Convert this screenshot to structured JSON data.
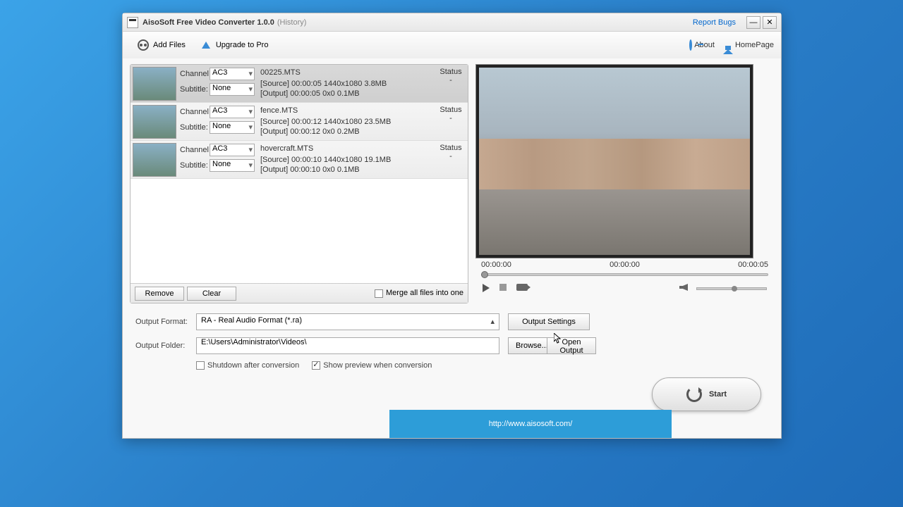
{
  "title": {
    "app": "AisoSoft Free Video Converter 1.0.0",
    "history": "(History)",
    "report": "Report Bugs"
  },
  "toolbar": {
    "addFiles": "Add Files",
    "upgrade": "Upgrade to Pro",
    "about": "About",
    "homepage": "HomePage"
  },
  "labels": {
    "channel": "Channel:",
    "subtitle": "Subtitle:",
    "status": "Status"
  },
  "files": [
    {
      "name": "00225.MTS",
      "channel": "AC3",
      "subtitle": "None",
      "source": "[Source]  00:00:05  1440x1080  3.8MB",
      "output": "[Output]  00:00:05  0x0  0.1MB",
      "status": "-",
      "sel": true
    },
    {
      "name": "fence.MTS",
      "channel": "AC3",
      "subtitle": "None",
      "source": "[Source]  00:00:12  1440x1080  23.5MB",
      "output": "[Output]  00:00:12  0x0  0.2MB",
      "status": "-",
      "sel": false
    },
    {
      "name": "hovercraft.MTS",
      "channel": "AC3",
      "subtitle": "None",
      "source": "[Source]  00:00:10  1440x1080  19.1MB",
      "output": "[Output]  00:00:10  0x0  0.1MB",
      "status": "-",
      "sel": false
    }
  ],
  "filebar": {
    "remove": "Remove",
    "clear": "Clear",
    "merge": "Merge all files into one"
  },
  "preview": {
    "t0": "00:00:00",
    "t1": "00:00:00",
    "t2": "00:00:05"
  },
  "output": {
    "formatLabel": "Output Format:",
    "format": "RA - Real Audio Format (*.ra)",
    "settings": "Output Settings",
    "folderLabel": "Output Folder:",
    "folder": "E:\\Users\\Administrator\\Videos\\",
    "browse": "Browse...",
    "open": "Open Output",
    "shutdown": "Shutdown after conversion",
    "previewChk": "Show preview when conversion"
  },
  "start": "Start",
  "banner": "http://www.aisosoft.com/"
}
